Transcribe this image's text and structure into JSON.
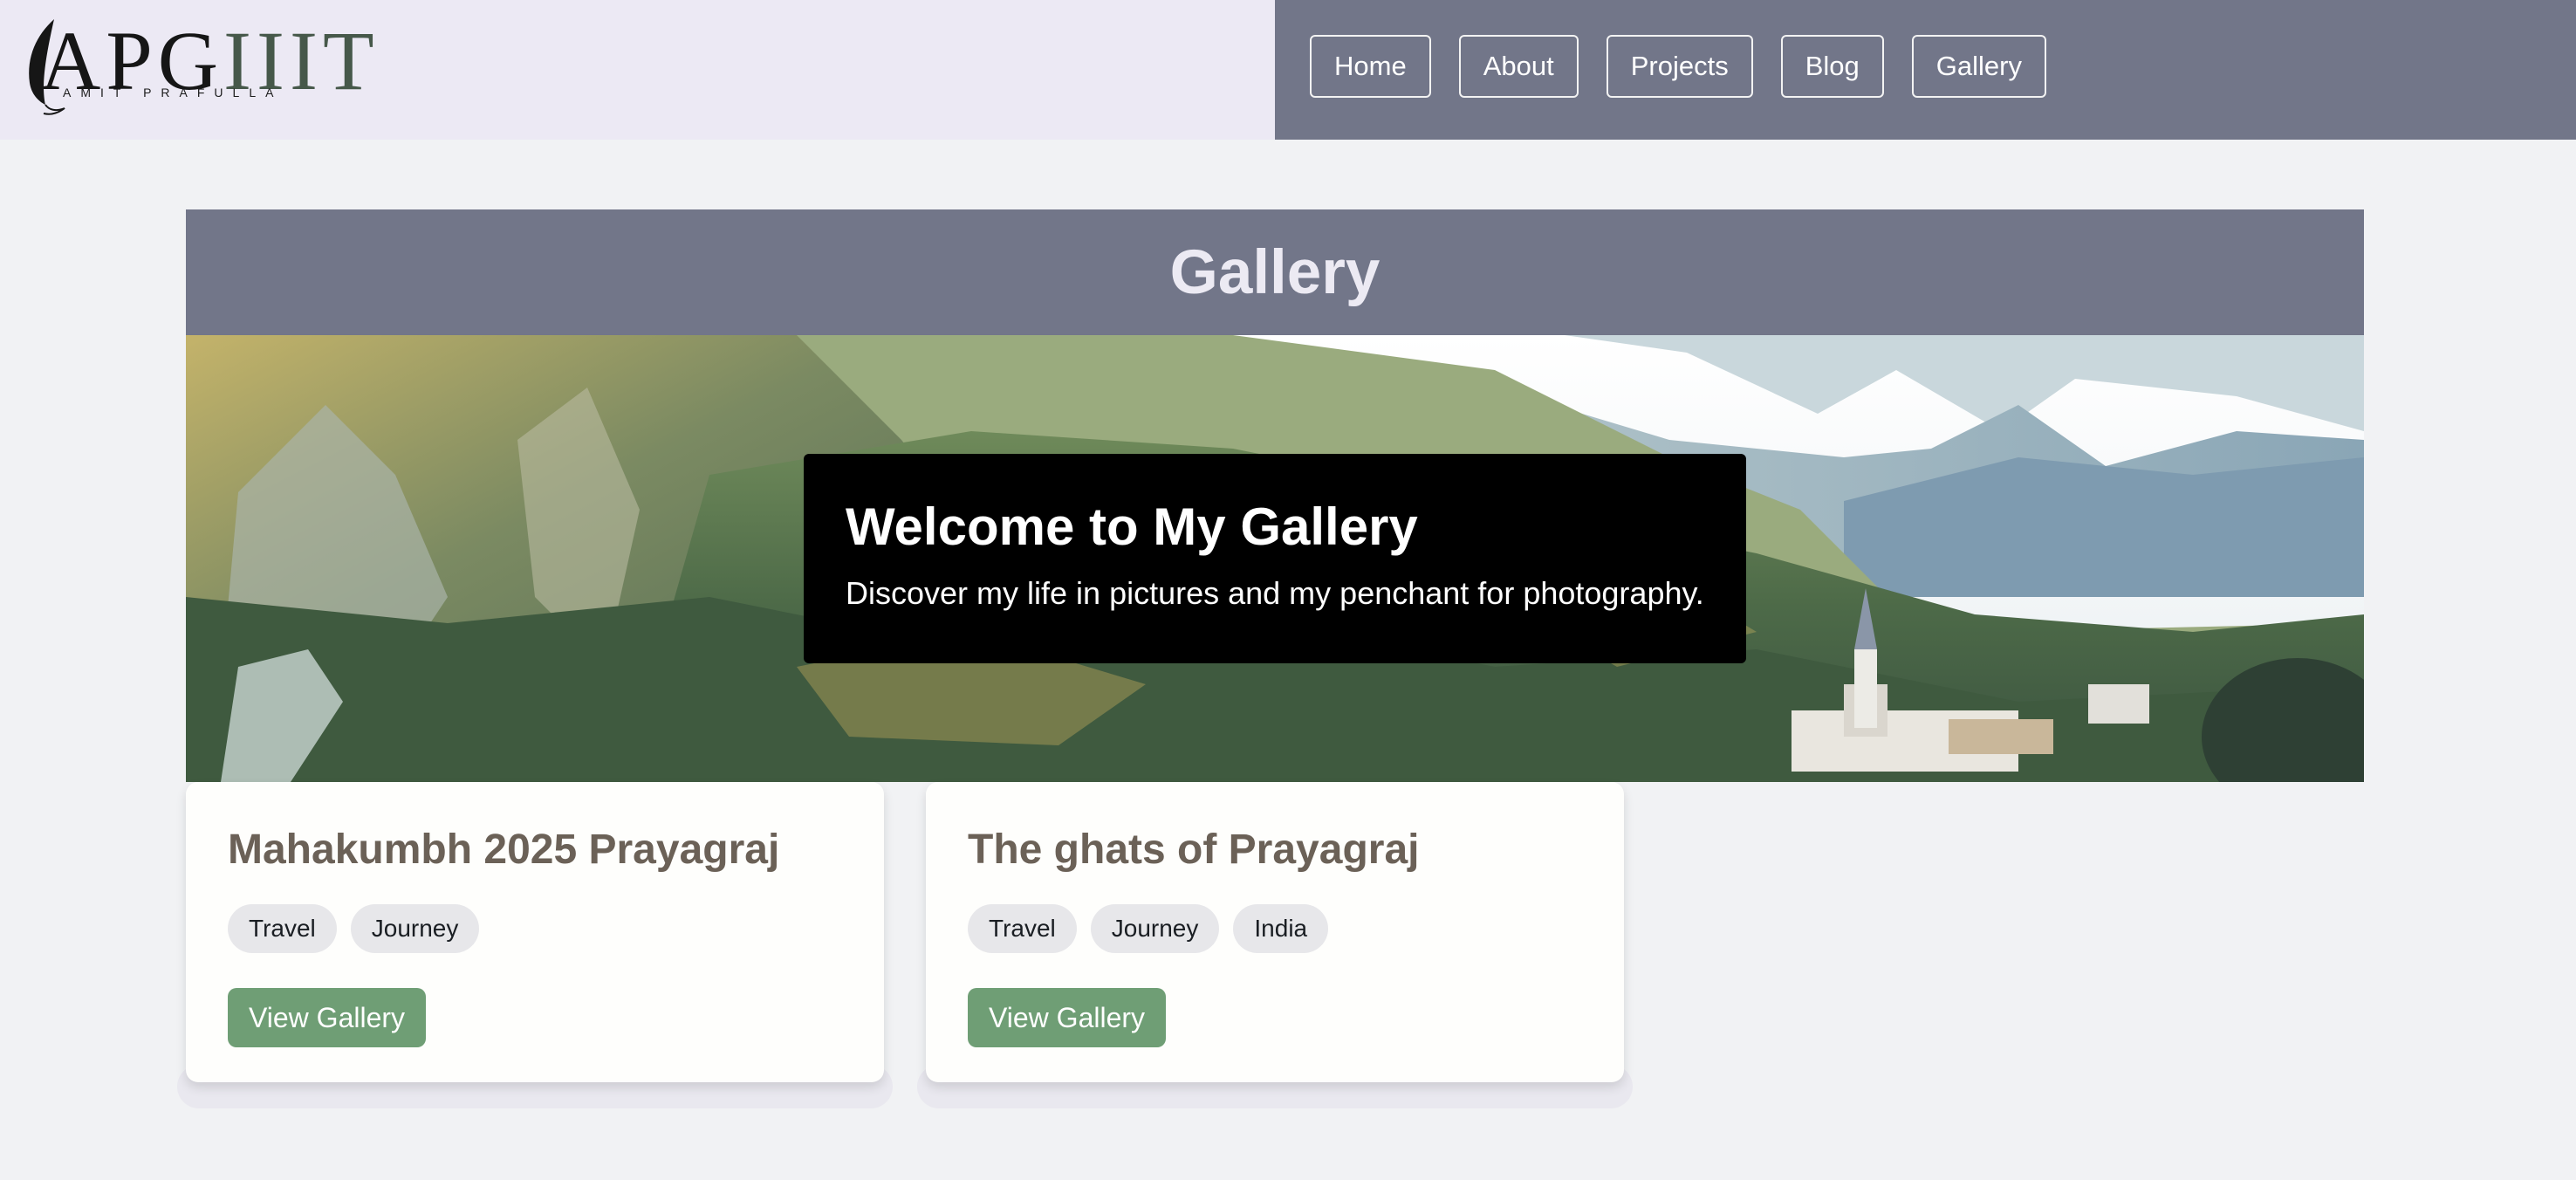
{
  "logo": {
    "letters_dark": "APG",
    "letters_green": "IIIT",
    "subtitle": "AMIT PRAFULLA",
    "colors": {
      "dark": "#161616",
      "green": "#46584a"
    }
  },
  "nav": {
    "items": [
      {
        "label": "Home"
      },
      {
        "label": "About"
      },
      {
        "label": "Projects"
      },
      {
        "label": "Blog"
      },
      {
        "label": "Gallery"
      }
    ]
  },
  "page": {
    "title": "Gallery"
  },
  "hero": {
    "heading": "Welcome to My Gallery",
    "subheading": "Discover my life in pictures and my penchant for photography."
  },
  "cards": [
    {
      "title": "Mahakumbh 2025 Prayagraj",
      "tags": [
        "Travel",
        "Journey"
      ],
      "button_label": "View Gallery"
    },
    {
      "title": "The ghats of Prayagraj",
      "tags": [
        "Travel",
        "Journey",
        "India"
      ],
      "button_label": "View Gallery"
    }
  ],
  "colors": {
    "header_left_bg": "#ece9f4",
    "nav_bg": "#727689",
    "page_bg": "#f1f2f4",
    "card_title": "#6b6157",
    "button_green": "#6f9e75",
    "tag_bg": "#e7e7ea"
  }
}
